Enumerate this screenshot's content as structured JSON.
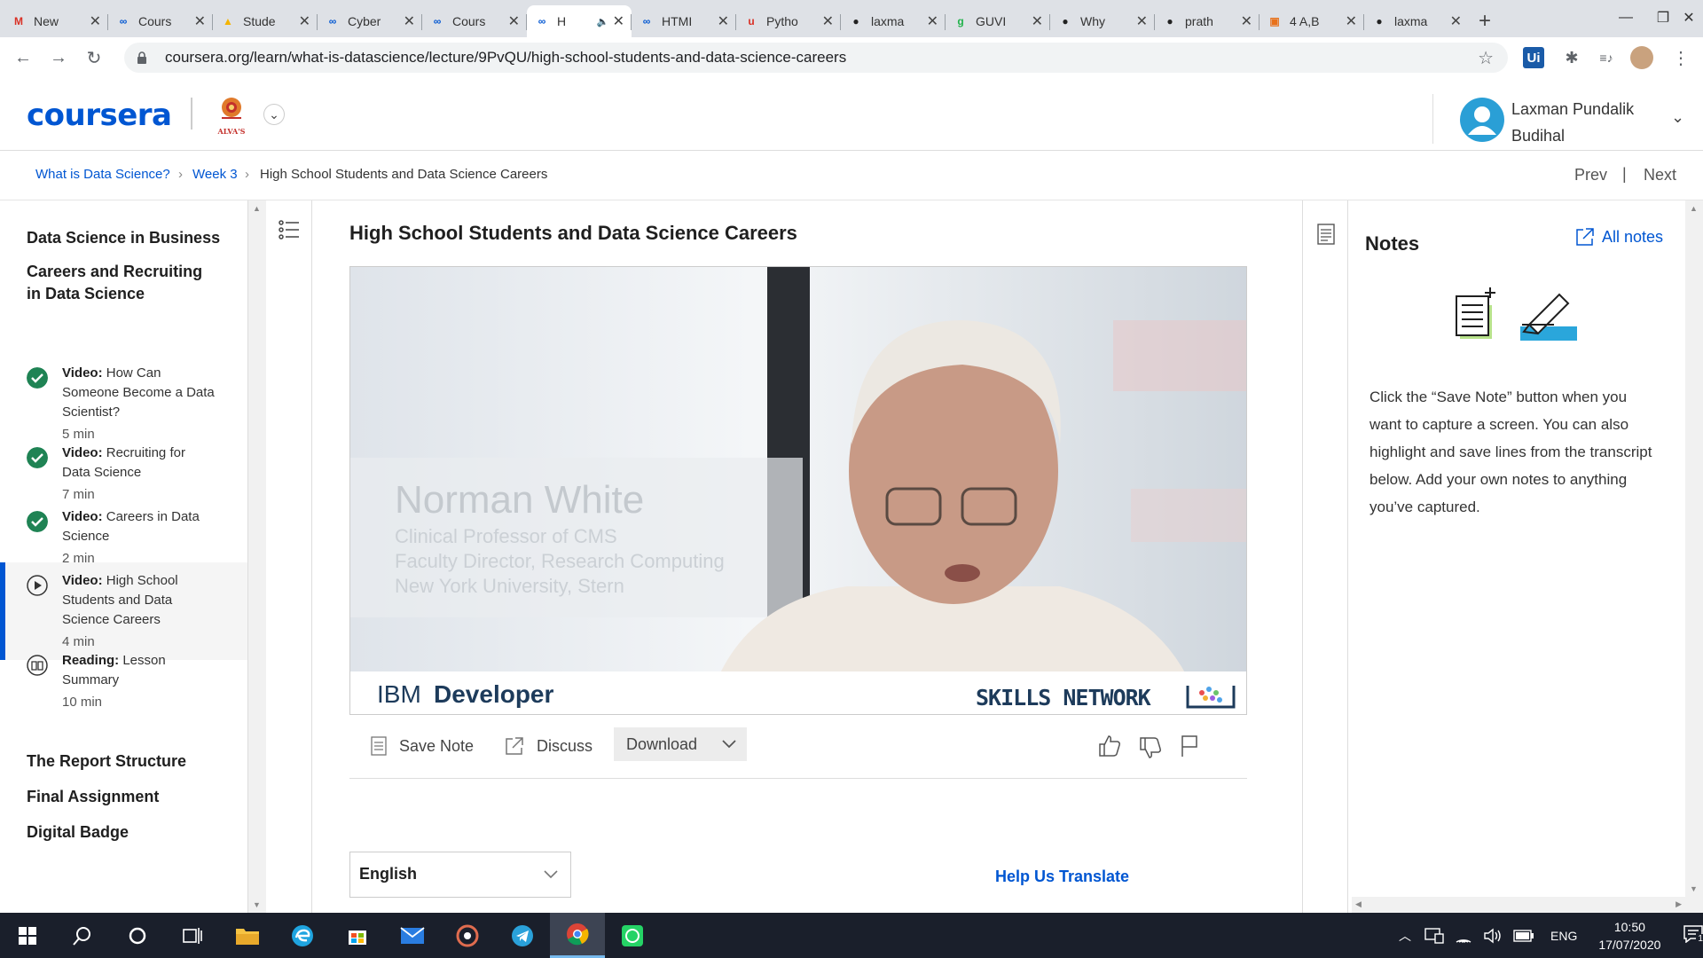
{
  "browser": {
    "tabs": [
      {
        "title": "New ",
        "favicon": "M",
        "fav_color": "#d93025"
      },
      {
        "title": "Cours",
        "favicon": "∞",
        "fav_color": "#0056d2"
      },
      {
        "title": "Stude",
        "favicon": "▲",
        "fav_color": "#f4b400"
      },
      {
        "title": "Cyber",
        "favicon": "∞",
        "fav_color": "#0056d2"
      },
      {
        "title": "Cours",
        "favicon": "∞",
        "fav_color": "#0056d2"
      },
      {
        "title": "H",
        "favicon": "∞",
        "fav_color": "#0056d2",
        "active": true,
        "audio": "🔈"
      },
      {
        "title": "HTMI",
        "favicon": "∞",
        "fav_color": "#0056d2"
      },
      {
        "title": "Pytho",
        "favicon": "u",
        "fav_color": "#d93025"
      },
      {
        "title": "laxma",
        "favicon": "●",
        "fav_color": "#222"
      },
      {
        "title": "GUVI",
        "favicon": "g",
        "fav_color": "#22b24c"
      },
      {
        "title": "Why",
        "favicon": "●",
        "fav_color": "#222"
      },
      {
        "title": "prath",
        "favicon": "●",
        "fav_color": "#222"
      },
      {
        "title": "4 A,B",
        "favicon": "▣",
        "fav_color": "#e8711a"
      },
      {
        "title": "laxma",
        "favicon": "●",
        "fav_color": "#222"
      }
    ],
    "new_tab": "+",
    "window_controls": {
      "minimize": "—",
      "maximize": "❐",
      "close": "✕"
    },
    "nav": {
      "back": "←",
      "forward": "→",
      "reload": "↻"
    },
    "url": "coursera.org/learn/what-is-datascience/lecture/9PvQU/high-school-students-and-data-science-careers",
    "star": "☆",
    "ext_ui": "Ui",
    "ext_puzzle": "✱",
    "ext_media": "≡♪"
  },
  "header": {
    "logo": "coursera",
    "partner_logo_text": "ALVA'S",
    "user_name_line1": "Laxman Pundalik",
    "user_name_line2": "Budihal",
    "chevron": "⌄"
  },
  "breadcrumb": {
    "course": "What is Data Science?",
    "week": "Week 3",
    "current": "High School Students and Data Science Careers",
    "separator": "›",
    "prev": "Prev",
    "divider": "|",
    "next": "Next"
  },
  "sidebar": {
    "modules_top": [
      "Data Science in Business"
    ],
    "module_current_l1": "Careers and Recruiting",
    "module_current_l2": "in Data Science",
    "items": [
      {
        "type": "Video:",
        "l1": "How Can",
        "l2": "Someone Become a Data",
        "l3": "Scientist?",
        "dur": "5 min",
        "status": "done"
      },
      {
        "type": "Video:",
        "l1": "Recruiting for",
        "l2": "Data Science",
        "l3": "",
        "dur": "7 min",
        "status": "done"
      },
      {
        "type": "Video:",
        "l1": "Careers in Data",
        "l2": "Science",
        "l3": "",
        "dur": "2 min",
        "status": "done"
      },
      {
        "type": "Video:",
        "l1": "High School",
        "l2": "Students and Data",
        "l3": "Science Careers",
        "dur": "4 min",
        "status": "current"
      },
      {
        "type": "Reading:",
        "l1": "Lesson",
        "l2": "Summary",
        "l3": "",
        "dur": "10 min",
        "status": "reading"
      }
    ],
    "modules_bottom": [
      "The Report Structure",
      "Final Assignment",
      "Digital Badge"
    ]
  },
  "lecture": {
    "title": "High School Students and Data Science Careers",
    "video": {
      "speaker_name": "Norman White",
      "speaker_title1": "Clinical Professor of CMS",
      "speaker_title2": "Faculty Director, Research Computing",
      "speaker_title3": "New York University, Stern",
      "brand_left_a": "IBM",
      "brand_left_b": "Developer",
      "brand_right": "SKILLS NETWORK"
    },
    "actions": {
      "save_note": "Save Note",
      "discuss": "Discuss",
      "download": "Download"
    },
    "language": "English",
    "help_translate": "Help Us Translate"
  },
  "notes": {
    "title": "Notes",
    "all_notes": "All notes",
    "hint_lines": [
      "Click the “Save Note” button when you",
      "want to capture a screen. You can also",
      "highlight and save lines from the transcript",
      "below. Add your own notes to anything",
      "you’ve captured."
    ]
  },
  "taskbar": {
    "lang": "ENG",
    "time": "10:50",
    "date": "17/07/2020",
    "notif_count": "1"
  },
  "colors": {
    "accent": "#0056d2",
    "check": "#1f8354",
    "taskbar": "#1a1f2b"
  }
}
